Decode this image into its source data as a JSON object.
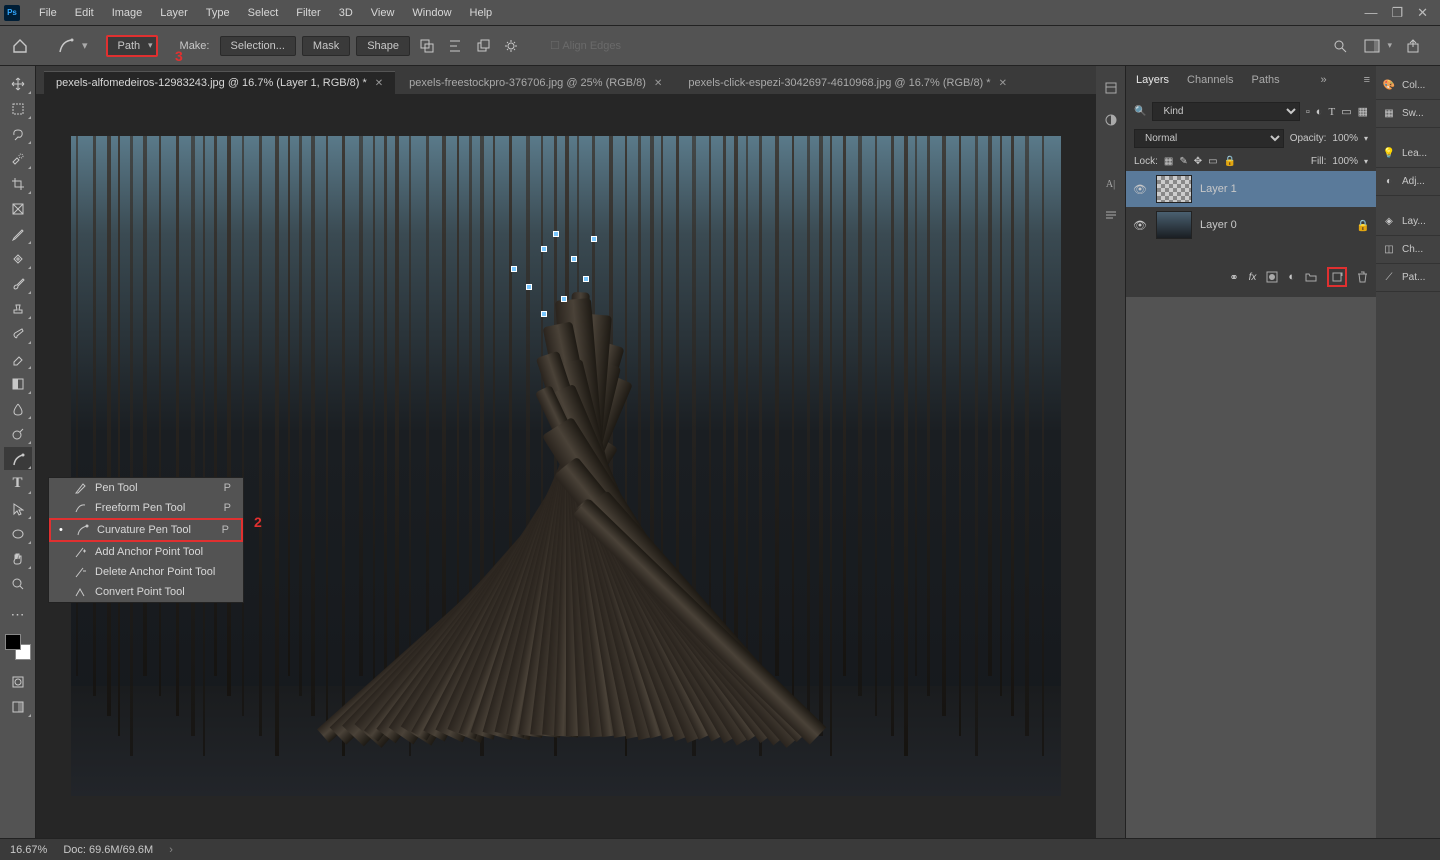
{
  "menubar": {
    "items": [
      "File",
      "Edit",
      "Image",
      "Layer",
      "Type",
      "Select",
      "Filter",
      "3D",
      "View",
      "Window",
      "Help"
    ]
  },
  "options_bar": {
    "mode_label": "Path",
    "make_label": "Make:",
    "selection_btn": "Selection...",
    "mask_btn": "Mask",
    "shape_btn": "Shape",
    "align_edges": "Align Edges"
  },
  "doc_tabs": [
    {
      "label": "pexels-alfomedeiros-12983243.jpg @ 16.7% (Layer 1, RGB/8) *",
      "active": true
    },
    {
      "label": "pexels-freestockpro-376706.jpg @ 25% (RGB/8)",
      "active": false
    },
    {
      "label": "pexels-click-espezi-3042697-4610968.jpg @ 16.7% (RGB/8) *",
      "active": false
    }
  ],
  "panels": {
    "tabs": [
      "Layers",
      "Channels",
      "Paths"
    ],
    "filter_label": "Kind",
    "blend_mode": "Normal",
    "opacity_label": "Opacity:",
    "opacity_value": "100%",
    "lock_label": "Lock:",
    "fill_label": "Fill:",
    "fill_value": "100%",
    "layers": [
      {
        "name": "Layer 1",
        "selected": true,
        "locked": false,
        "thumb": "trans"
      },
      {
        "name": "Layer 0",
        "selected": false,
        "locked": true,
        "thumb": "img"
      }
    ]
  },
  "right_collapsed": [
    {
      "icon": "palette",
      "label": "Col..."
    },
    {
      "icon": "swatches",
      "label": "Sw..."
    },
    {
      "icon": "bulb",
      "label": "Lea..."
    },
    {
      "icon": "adjust",
      "label": "Adj..."
    },
    {
      "icon": "layers",
      "label": "Lay..."
    },
    {
      "icon": "channels",
      "label": "Ch..."
    },
    {
      "icon": "paths",
      "label": "Pat..."
    }
  ],
  "flyout": {
    "items": [
      {
        "label": "Pen Tool",
        "shortcut": "P",
        "active": false
      },
      {
        "label": "Freeform Pen Tool",
        "shortcut": "P",
        "active": false
      },
      {
        "label": "Curvature Pen Tool",
        "shortcut": "P",
        "active": true
      },
      {
        "label": "Add Anchor Point Tool",
        "shortcut": "",
        "active": false
      },
      {
        "label": "Delete Anchor Point Tool",
        "shortcut": "",
        "active": false
      },
      {
        "label": "Convert Point Tool",
        "shortcut": "",
        "active": false
      }
    ]
  },
  "status": {
    "zoom": "16.67%",
    "doc_info": "Doc: 69.6M/69.6M"
  },
  "annotations": {
    "step2": "2",
    "step3": "3"
  }
}
